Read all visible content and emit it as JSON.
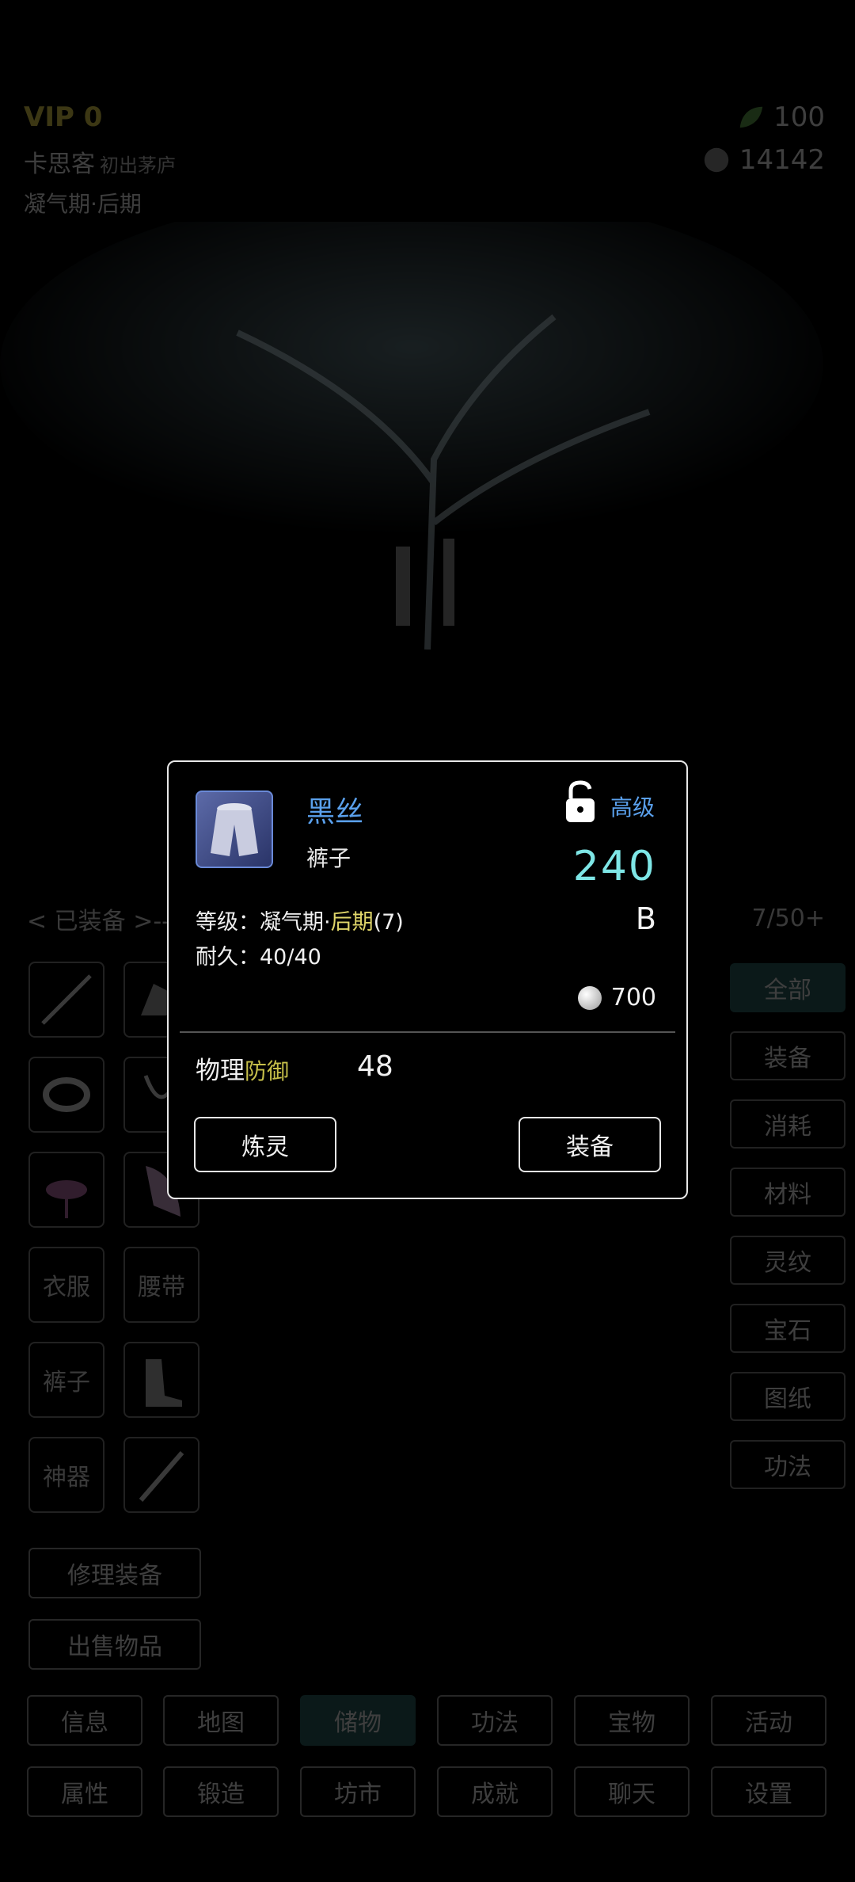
{
  "header": {
    "vip": "VIP 0",
    "player_name": "卡思客",
    "player_title": "初出茅庐",
    "realm": "凝气期·后期",
    "resource1": "100",
    "resource2": "14142"
  },
  "equipment": {
    "label": "< 已装备 >---",
    "slots": [
      "衣服",
      "腰带",
      "裤子",
      "神器"
    ],
    "repair_button": "修理装备",
    "sell_button": "出售物品",
    "bag_count": "7/50+"
  },
  "filters": [
    "全部",
    "装备",
    "消耗",
    "材料",
    "灵纹",
    "宝石",
    "图纸",
    "功法"
  ],
  "nav_row1": [
    "信息",
    "地图",
    "储物",
    "功法",
    "宝物",
    "活动"
  ],
  "nav_row2": [
    "属性",
    "锻造",
    "坊市",
    "成就",
    "聊天",
    "设置"
  ],
  "item": {
    "name": "黑丝",
    "type": "裤子",
    "tier": "高级",
    "score": "240",
    "grade": "B",
    "level_prefix": "等级：凝气期·",
    "level_stage": "后期",
    "level_suffix": "(7)",
    "durability": "耐久：40/40",
    "price": "700",
    "stat_prefix": "物理",
    "stat_name": "防御",
    "stat_value": "48",
    "refine_button": "炼灵",
    "equip_button": "装备"
  },
  "colors": {
    "accent_blue": "#5aa0ec",
    "score_cyan": "#7ee6e6",
    "active_tab": "#2a5a5a"
  }
}
